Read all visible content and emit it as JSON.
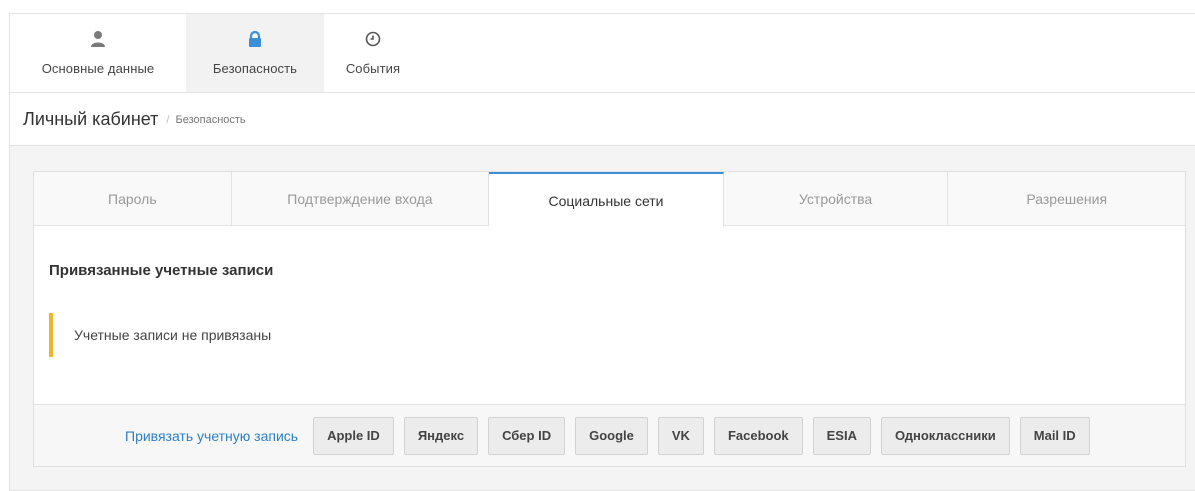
{
  "topnav": {
    "items": [
      {
        "label": "Основные данные",
        "icon": "user-icon",
        "active": false
      },
      {
        "label": "Безопасность",
        "icon": "lock-icon",
        "active": true
      },
      {
        "label": "События",
        "icon": "clock-icon",
        "active": false
      }
    ]
  },
  "header": {
    "title": "Личный кабинет",
    "separator": "/",
    "breadcrumb_current": "Безопасность"
  },
  "tabs": [
    {
      "label": "Пароль",
      "active": false
    },
    {
      "label": "Подтверждение входа",
      "active": false
    },
    {
      "label": "Социальные сети",
      "active": true
    },
    {
      "label": "Устройства",
      "active": false
    },
    {
      "label": "Разрешения",
      "active": false
    }
  ],
  "content": {
    "section_title": "Привязанные учетные записи",
    "empty_message": "Учетные записи не привязаны"
  },
  "footer": {
    "link_label": "Привязать учетную запись",
    "providers": [
      "Apple ID",
      "Яндекс",
      "Сбер ID",
      "Google",
      "VK",
      "Facebook",
      "ESIA",
      "Одноклассники",
      "Mail ID"
    ]
  },
  "colors": {
    "accent": "#3a8fd8",
    "link": "#2d7fc9",
    "alert_border": "#f0b429",
    "icon_gray": "#7a7a7a"
  }
}
